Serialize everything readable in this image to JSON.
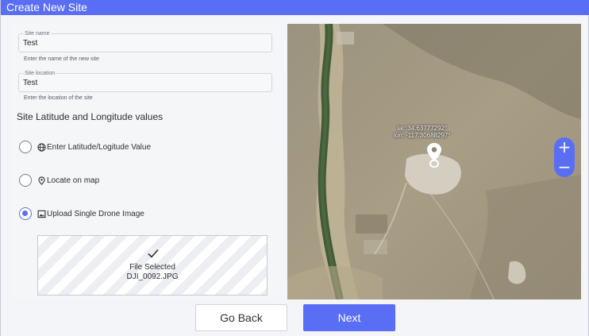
{
  "dialog": {
    "title": "Create New Site"
  },
  "site_name": {
    "label": "Site name",
    "value": "Test",
    "helper": "Enter the name of the new site"
  },
  "site_location": {
    "label": "Site location",
    "value": "Test",
    "helper": "Enter the location of the site"
  },
  "section_title": "Site Latitude and Longitude values",
  "options": [
    {
      "label": "Enter Latitude/Logitude Value",
      "icon": "globe-icon",
      "checked": false
    },
    {
      "label": "Locate on map",
      "icon": "location-pin-icon",
      "checked": false
    },
    {
      "label": "Upload Single Drone Image",
      "icon": "image-icon",
      "checked": true
    }
  ],
  "upload": {
    "status": "File Selected",
    "filename": "DJI_0092.JPG",
    "icon": "checkmark-icon"
  },
  "map": {
    "lat_label": "lat: 34.63777292°",
    "lon_label": "lon: -117.30688297°",
    "zoom_in": "+",
    "zoom_out": "−"
  },
  "buttons": {
    "back": "Go Back",
    "next": "Next"
  },
  "colors": {
    "accent": "#5a6ef5"
  }
}
